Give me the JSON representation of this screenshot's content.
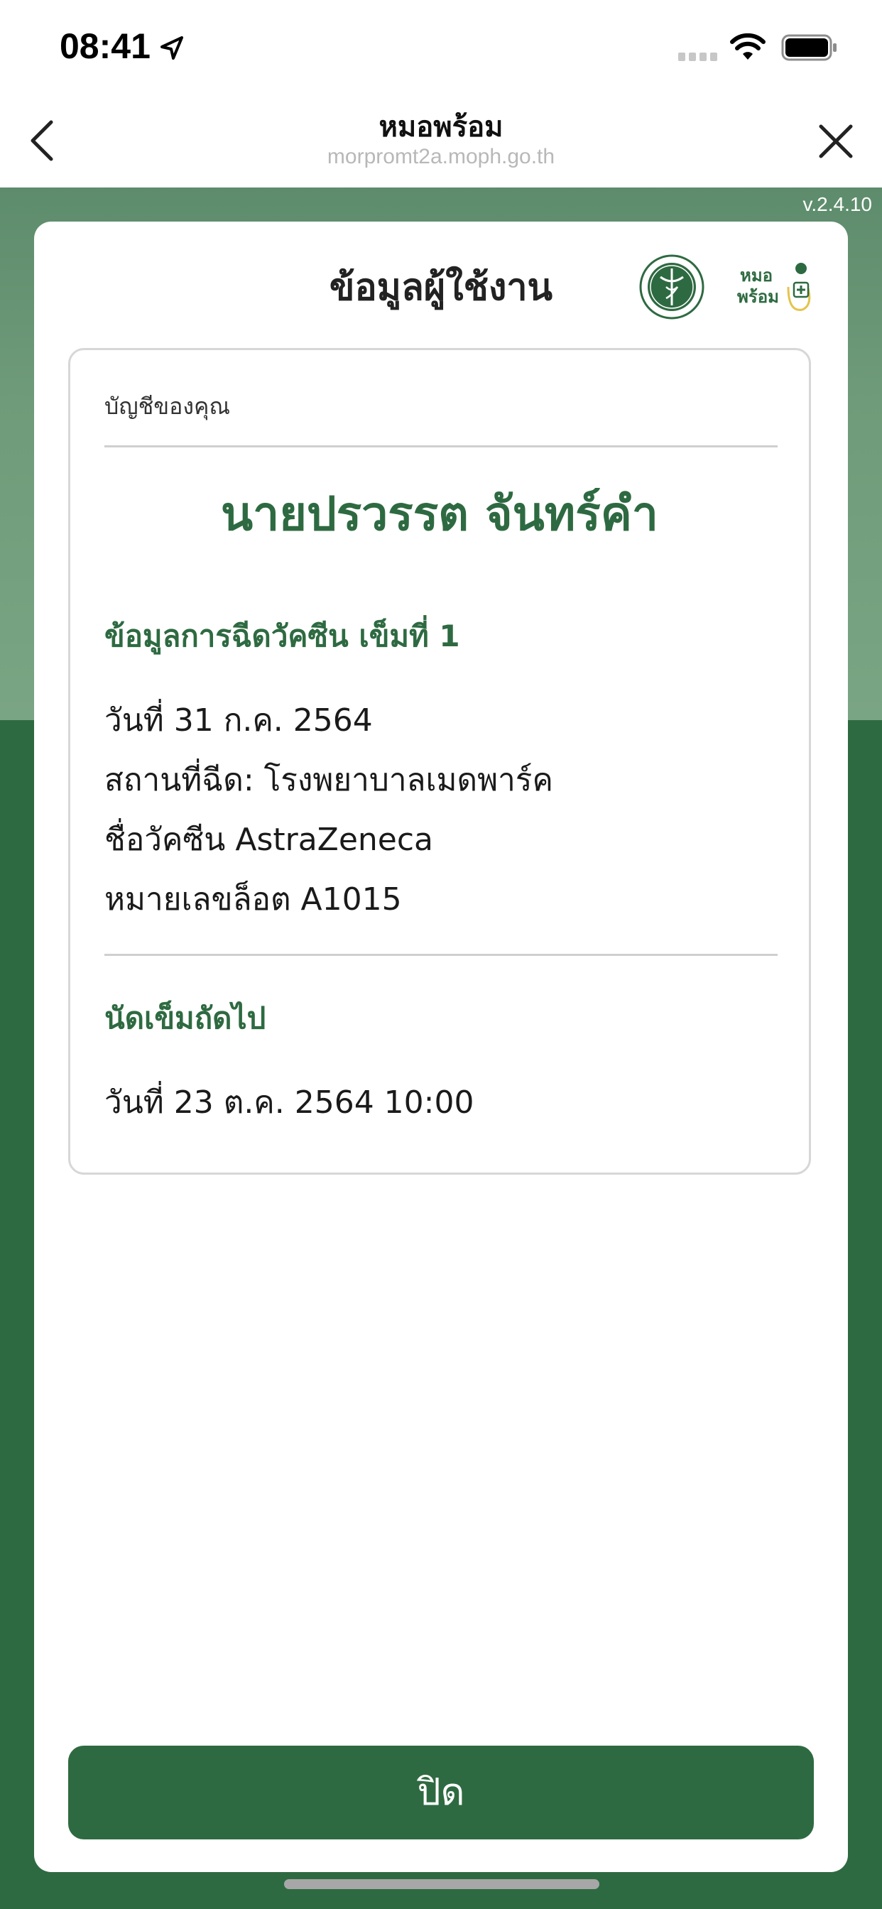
{
  "status_bar": {
    "time": "08:41"
  },
  "nav": {
    "title": "หมอพร้อม",
    "url": "morpromt2a.moph.go.th"
  },
  "version": "v.2.4.10",
  "modal": {
    "title": "ข้อมูลผู้ใช้งาน",
    "logos": {
      "moph": "ministry-of-public-health-seal",
      "app": {
        "line1": "หมอ",
        "line2": "พร้อม"
      }
    },
    "account_label": "บัญชีของคุณ",
    "user_name": "นายปรวรรต จันทร์คำ",
    "vaccine_section": {
      "heading": "ข้อมูลการฉีดวัคซีน เข็มที่ 1",
      "date": "วันที่ 31 ก.ค. 2564",
      "place": "สถานที่ฉีด: โรงพยาบาลเมดพาร์ค",
      "vaccine_name": "ชื่อวัคซีน AstraZeneca",
      "lot_number": "หมายเลขล็อต A1015"
    },
    "next_appointment": {
      "heading": "นัดเข็มถัดไป",
      "date": "วันที่ 23 ต.ค. 2564 10:00"
    },
    "close_button_label": "ปิด"
  },
  "colors": {
    "brand_green": "#2e6a41",
    "light_green_bg": "#6f9b7a",
    "divider": "#cfcfcf"
  }
}
